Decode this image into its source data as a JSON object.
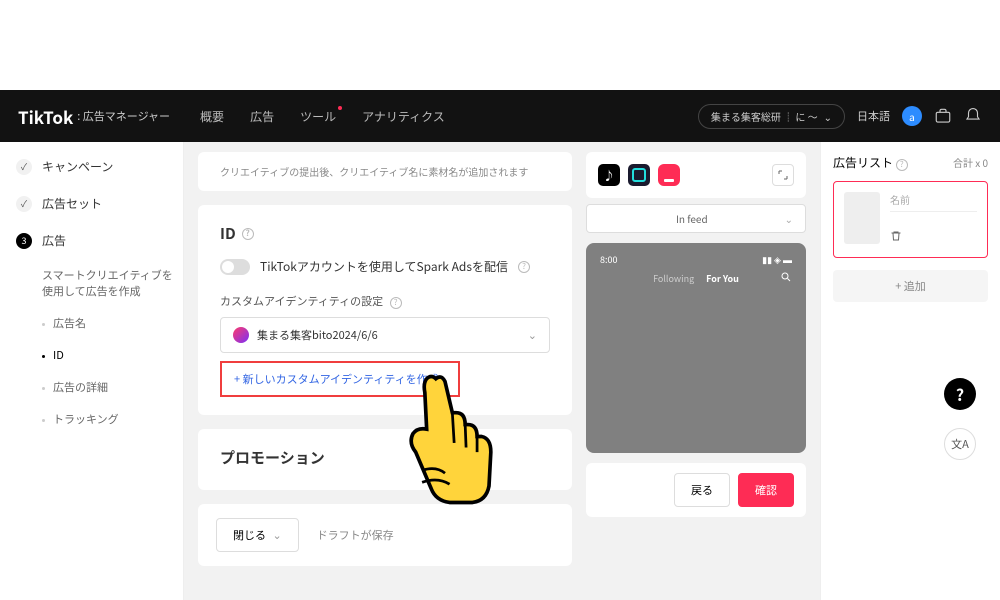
{
  "header": {
    "brand": "TikTok",
    "brand_suffix": ": 広告マネージャー",
    "nav": [
      "概要",
      "広告",
      "ツール",
      "アナリティクス"
    ],
    "account_pill": "集まる集客総研 ┊ に 〜",
    "language": "日本語",
    "avatar_letter": "a"
  },
  "sidebar": {
    "steps": [
      {
        "label": "キャンペーン",
        "type": "check"
      },
      {
        "label": "広告セット",
        "type": "check"
      },
      {
        "label": "広告",
        "type": "num",
        "num": "3"
      }
    ],
    "subs": [
      "スマートクリエイティブを使用して広告を作成",
      "広告名",
      "ID",
      "広告の詳細",
      "トラッキング"
    ],
    "active_sub": 2
  },
  "main": {
    "hint": "クリエイティブの提出後、クリエイティブ名に素材名が追加されます",
    "id_section": {
      "title": "ID",
      "toggle_label": "TikTokアカウントを使用してSpark Adsを配信",
      "field_label": "カスタムアイデンティティの設定",
      "selected": "集まる集客bito2024/6/6",
      "create_link": "+ 新しいカスタムアイデンティティを作成"
    },
    "promo_title": "プロモーション",
    "close_btn": "閉じる",
    "draft_saved": "ドラフトが保存"
  },
  "preview": {
    "dropdown": "In feed",
    "phone_time": "8:00",
    "tabs": [
      "Following",
      "For You"
    ],
    "back": "戻る",
    "confirm": "確認"
  },
  "rightpanel": {
    "title": "広告リスト",
    "count": "合計 x 0",
    "name_placeholder": "名前",
    "add": "+ 追加"
  },
  "fab": {
    "help": "?",
    "lang": "文A"
  }
}
